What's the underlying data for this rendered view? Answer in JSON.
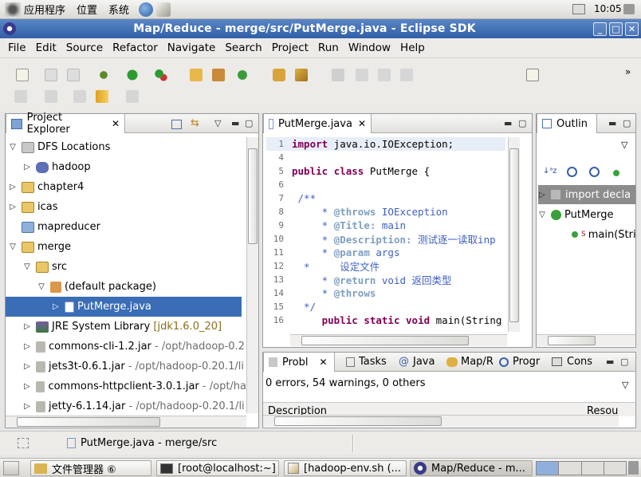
{
  "gnome_panel": {
    "menus": [
      "应用程序",
      "位置",
      "系统"
    ],
    "clock": "10:05"
  },
  "window": {
    "title": "Map/Reduce - merge/src/PutMerge.java - Eclipse SDK"
  },
  "menubar": [
    "File",
    "Edit",
    "Source",
    "Refactor",
    "Navigate",
    "Search",
    "Project",
    "Run",
    "Window",
    "Help"
  ],
  "project_explorer": {
    "tab_label": "Project Explorer",
    "tree": [
      {
        "label": "DFS Locations",
        "extra": "",
        "expanded": true
      },
      {
        "label": "hadoop",
        "extra": "",
        "expanded": false
      },
      {
        "label": "chapter4",
        "extra": "",
        "expanded": false
      },
      {
        "label": "icas",
        "extra": "",
        "expanded": false
      },
      {
        "label": "mapreducer",
        "extra": "",
        "expanded": false
      },
      {
        "label": "merge",
        "extra": "",
        "expanded": true
      },
      {
        "label": "src",
        "extra": "",
        "expanded": true
      },
      {
        "label": "(default package)",
        "extra": "",
        "expanded": true
      },
      {
        "label": "PutMerge.java",
        "extra": "",
        "expanded": false
      },
      {
        "label": "JRE System Library",
        "extra": "[jdk1.6.0_20]",
        "expanded": false
      },
      {
        "label": "commons-cli-1.2.jar",
        "extra": "- /opt/hadoop-0.2",
        "expanded": false
      },
      {
        "label": "jets3t-0.6.1.jar",
        "extra": "- /opt/hadoop-0.20.1/li",
        "expanded": false
      },
      {
        "label": "commons-httpclient-3.0.1.jar",
        "extra": "- /opt/ha",
        "expanded": false
      },
      {
        "label": "jetty-6.1.14.jar",
        "extra": "- /opt/hadoop-0.20.1/li",
        "expanded": false
      }
    ]
  },
  "editor": {
    "tab_label": "PutMerge.java",
    "lines": [
      {
        "n": "1",
        "parts": [
          [
            "kw",
            "import"
          ],
          [
            "",
            " java.io.IOException;"
          ]
        ]
      },
      {
        "n": "4",
        "parts": []
      },
      {
        "n": "5",
        "parts": [
          [
            "kw",
            "public"
          ],
          [
            "",
            " "
          ],
          [
            "kw",
            "class"
          ],
          [
            "",
            " PutMerge {"
          ]
        ]
      },
      {
        "n": "6",
        "parts": []
      },
      {
        "n": "7",
        "parts": [
          [
            "jd",
            " /**"
          ]
        ]
      },
      {
        "n": "8",
        "parts": [
          [
            "jd",
            "     * "
          ],
          [
            "jt",
            "@throws"
          ],
          [
            "jd",
            " IOException"
          ]
        ]
      },
      {
        "n": "9",
        "parts": [
          [
            "jd",
            "     * "
          ],
          [
            "jt",
            "@Title:"
          ],
          [
            "jd",
            " main"
          ]
        ]
      },
      {
        "n": "10",
        "parts": [
          [
            "jd",
            "     * "
          ],
          [
            "jt",
            "@Description:"
          ],
          [
            "jd",
            " 测试逐一读取inp"
          ]
        ]
      },
      {
        "n": "11",
        "parts": [
          [
            "jd",
            "     * "
          ],
          [
            "jt",
            "@param"
          ],
          [
            "jd",
            " args"
          ]
        ]
      },
      {
        "n": "12",
        "parts": [
          [
            "jd",
            "  *     设定文件"
          ]
        ]
      },
      {
        "n": "13",
        "parts": [
          [
            "jd",
            "     * "
          ],
          [
            "jt",
            "@return"
          ],
          [
            "jd",
            " void 返回类型"
          ]
        ]
      },
      {
        "n": "14",
        "parts": [
          [
            "jd",
            "     * "
          ],
          [
            "jt",
            "@throws"
          ]
        ]
      },
      {
        "n": "15",
        "parts": [
          [
            "jd",
            "  */"
          ]
        ]
      },
      {
        "n": "16",
        "parts": [
          [
            "",
            " "
          ],
          [
            "kw",
            "    public"
          ],
          [
            "",
            " "
          ],
          [
            "kw",
            "static"
          ],
          [
            "",
            " "
          ],
          [
            "kw",
            "void"
          ],
          [
            "",
            " main(String"
          ]
        ]
      }
    ]
  },
  "outline": {
    "tab_label": "Outlin",
    "items": [
      "import decla",
      "PutMerge",
      "main(Stri"
    ]
  },
  "bottom_panel": {
    "tabs": [
      "Probl",
      "Tasks",
      "Java",
      "Map/R",
      "Progr",
      "Cons"
    ],
    "summary": "0 errors, 54 warnings, 0 others",
    "col_description": "Description",
    "col_resource": "Resou"
  },
  "statusbar": {
    "text": "PutMerge.java - merge/src"
  },
  "taskbar": {
    "items": [
      "文件管理器 ⑥",
      "[root@localhost:~]",
      "[hadoop-env.sh (...",
      "Map/Reduce - m..."
    ]
  },
  "colors": {
    "titlebar": "#3a68b0",
    "selection": "#3a6db5",
    "keyword": "#7f0055",
    "javadoc": "#3f5fbf"
  }
}
